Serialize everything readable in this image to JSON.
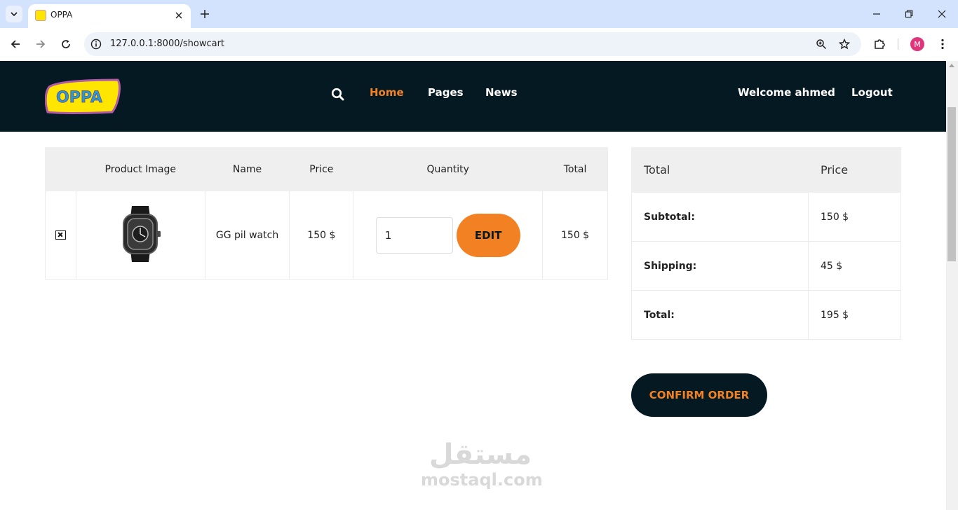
{
  "browser": {
    "tab_title": "OPPA",
    "url": "127.0.0.1:8000/showcart",
    "profile_initial": "M"
  },
  "header": {
    "nav": {
      "home": "Home",
      "pages": "Pages",
      "news": "News"
    },
    "welcome": "Welcome ahmed",
    "logout": "Logout",
    "logo_text": "OPPA"
  },
  "cart": {
    "columns": [
      "",
      "Product Image",
      "Name",
      "Price",
      "Quantity",
      "Total"
    ],
    "rows": [
      {
        "name": "GG pil watch",
        "price": "150 $",
        "quantity": "1",
        "total": "150 $",
        "edit_label": "EDIT"
      }
    ]
  },
  "totals": {
    "headers": [
      "Total",
      "Price"
    ],
    "rows": [
      {
        "label": "Subtotal:",
        "value": "150 $"
      },
      {
        "label": "Shipping:",
        "value": "45 $"
      },
      {
        "label": "Total:",
        "value": "195 $"
      }
    ]
  },
  "confirm_label": "CONFIRM ORDER",
  "watermark": {
    "arabic": "مستقل",
    "latin": "mostaql.com"
  },
  "colors": {
    "header_bg": "#051922",
    "accent": "#f28123"
  }
}
